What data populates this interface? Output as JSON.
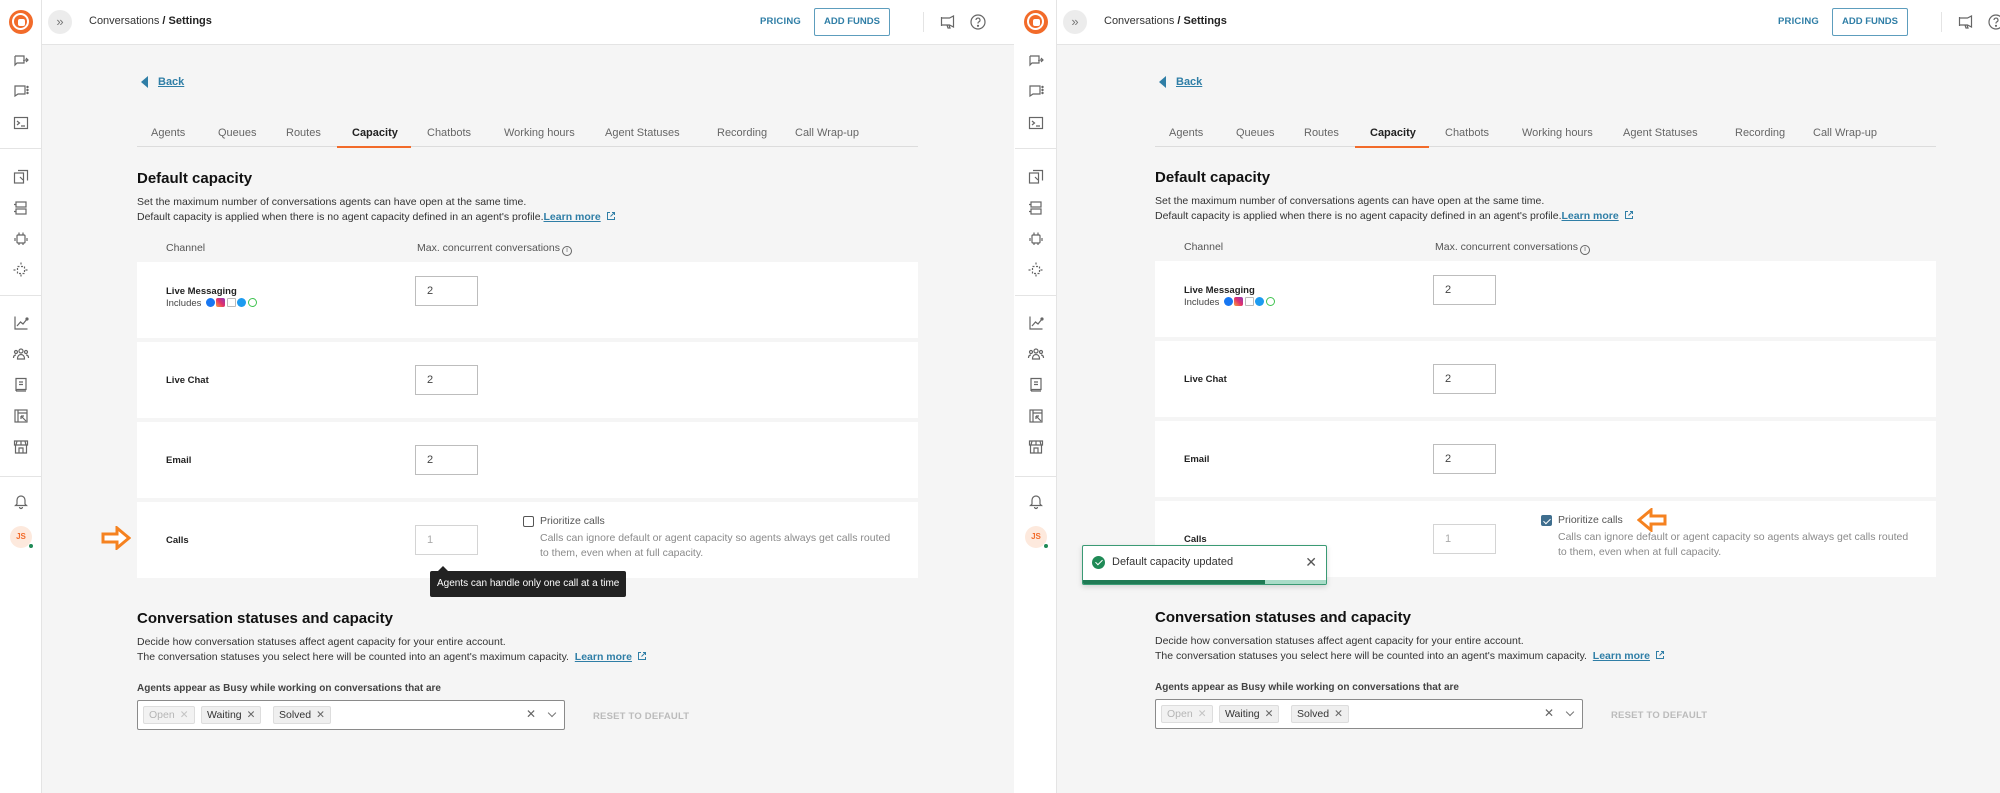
{
  "panels": [
    {
      "header": {
        "breadcrumb_parent": "Conversations",
        "breadcrumb_sep": " / ",
        "breadcrumb_current": "Settings",
        "pricing_label": "PRICING",
        "add_funds_label": "ADD FUNDS"
      },
      "user_initials": "JS",
      "back_label": "Back",
      "tabs": [
        "Agents",
        "Queues",
        "Routes",
        "Capacity",
        "Chatbots",
        "Working hours",
        "Agent Statuses",
        "Recording",
        "Call Wrap-up"
      ],
      "active_tab": "Capacity",
      "default_capacity": {
        "title": "Default capacity",
        "desc_line1": "Set the maximum number of conversations agents can have open at the same time.",
        "desc_line2": "Default capacity is applied when there is no agent capacity defined in an agent's profile.",
        "learn_more": "Learn more",
        "col_channel": "Channel",
        "col_max": "Max. concurrent conversations",
        "rows": [
          {
            "name": "Live Messaging",
            "sub": "Includes",
            "value": "2"
          },
          {
            "name": "Live Chat",
            "value": "2"
          },
          {
            "name": "Email",
            "value": "2"
          },
          {
            "name": "Calls",
            "value": "1"
          }
        ],
        "prioritize_label": "Prioritize calls",
        "prioritize_checked": false,
        "prioritize_help": "Calls can ignore default or agent capacity so agents always get calls routed to them, even when at full capacity."
      },
      "tooltip": "Agents can handle only one call at a time",
      "statuses": {
        "title": "Conversation statuses and capacity",
        "desc_line1": "Decide how conversation statuses affect agent capacity for your entire account.",
        "desc_line2": "The conversation statuses you select here will be counted into an agent's maximum capacity.",
        "learn_more": "Learn more",
        "select_label": "Agents appear as Busy while working on conversations that are",
        "chips": [
          {
            "label": "Open",
            "disabled": true
          },
          {
            "label": "Waiting",
            "disabled": false
          },
          {
            "label": "Solved",
            "disabled": false
          }
        ],
        "reset_label": "RESET TO DEFAULT"
      }
    },
    {
      "header": {
        "breadcrumb_parent": "Conversations",
        "breadcrumb_sep": " / ",
        "breadcrumb_current": "Settings",
        "pricing_label": "PRICING",
        "add_funds_label": "ADD FUNDS"
      },
      "user_initials": "JS",
      "back_label": "Back",
      "tabs": [
        "Agents",
        "Queues",
        "Routes",
        "Capacity",
        "Chatbots",
        "Working hours",
        "Agent Statuses",
        "Recording",
        "Call Wrap-up"
      ],
      "active_tab": "Capacity",
      "default_capacity": {
        "title": "Default capacity",
        "desc_line1": "Set the maximum number of conversations agents can have open at the same time.",
        "desc_line2": "Default capacity is applied when there is no agent capacity defined in an agent's profile.",
        "learn_more": "Learn more",
        "col_channel": "Channel",
        "col_max": "Max. concurrent conversations",
        "rows": [
          {
            "name": "Live Messaging",
            "sub": "Includes",
            "value": "2"
          },
          {
            "name": "Live Chat",
            "value": "2"
          },
          {
            "name": "Email",
            "value": "2"
          },
          {
            "name": "Calls",
            "value": "1"
          }
        ],
        "prioritize_label": "Prioritize calls",
        "prioritize_checked": true,
        "prioritize_help": "Calls can ignore default or agent capacity so agents always get calls routed to them, even when at full capacity."
      },
      "toast": {
        "message": "Default capacity updated",
        "progress": 0.75
      },
      "statuses": {
        "title": "Conversation statuses and capacity",
        "desc_line1": "Decide how conversation statuses affect agent capacity for your entire account.",
        "desc_line2": "The conversation statuses you select here will be counted into an agent's maximum capacity.",
        "learn_more": "Learn more",
        "select_label": "Agents appear as Busy while working on conversations that are",
        "chips": [
          {
            "label": "Open",
            "disabled": true
          },
          {
            "label": "Waiting",
            "disabled": false
          },
          {
            "label": "Solved",
            "disabled": false
          }
        ],
        "reset_label": "RESET TO DEFAULT"
      }
    }
  ],
  "colors": {
    "brand_orange": "#f26b2a",
    "link_blue": "#2f7ea6",
    "success_green": "#1f8a56",
    "annotation_arrow": "#f58220"
  }
}
